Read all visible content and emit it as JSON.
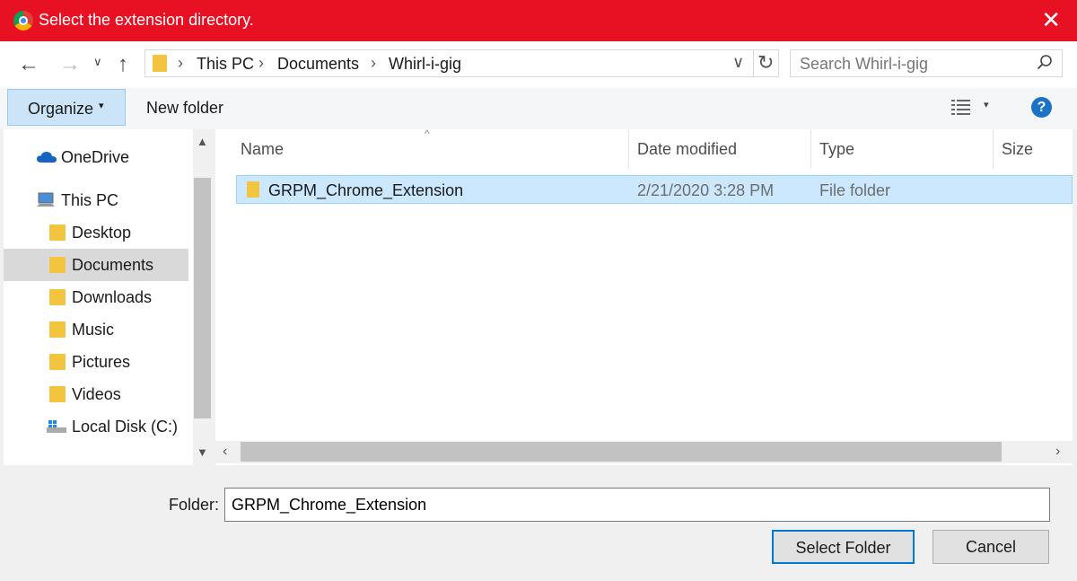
{
  "window": {
    "title": "Select the extension directory.",
    "close_label": "✕"
  },
  "address": {
    "breadcrumbs": [
      "This PC",
      "Documents",
      "Whirl-i-gig"
    ],
    "search_placeholder": "Search Whirl-i-gig"
  },
  "toolbar": {
    "organize_label": "Organize",
    "new_folder_label": "New folder",
    "help_label": "?"
  },
  "nav": {
    "items": [
      {
        "label": "OneDrive"
      },
      {
        "label": "This PC"
      },
      {
        "label": "Desktop"
      },
      {
        "label": "Documents"
      },
      {
        "label": "Downloads"
      },
      {
        "label": "Music"
      },
      {
        "label": "Pictures"
      },
      {
        "label": "Videos"
      },
      {
        "label": "Local Disk (C:)"
      }
    ],
    "selected": "Documents"
  },
  "files": {
    "columns": [
      "Name",
      "Date modified",
      "Type",
      "Size"
    ],
    "rows": [
      {
        "name": "GRPM_Chrome_Extension",
        "date_modified": "2/21/2020 3:28 PM",
        "type": "File folder",
        "size": ""
      }
    ]
  },
  "footer": {
    "folder_label": "Folder:",
    "folder_value": "GRPM_Chrome_Extension",
    "select_label": "Select Folder",
    "cancel_label": "Cancel"
  },
  "colors": {
    "titlebar": "#e81123",
    "selection": "#cce8ff",
    "accent": "#0078d7"
  }
}
